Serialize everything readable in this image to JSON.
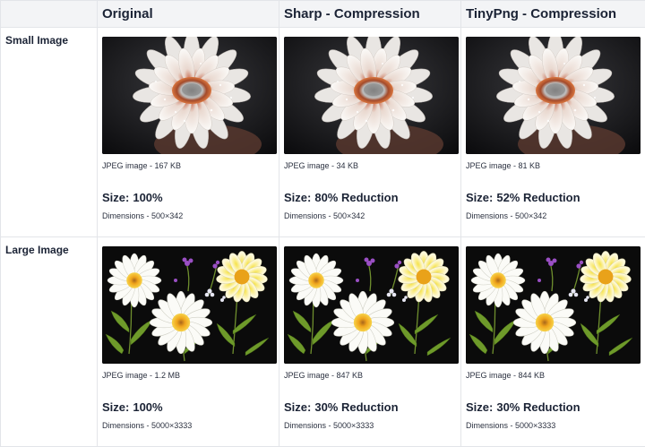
{
  "header": {
    "corner": "",
    "col_original": "Original",
    "col_sharp": "Sharp - Compression",
    "col_tinypng": "TinyPng - Compression"
  },
  "rows": [
    {
      "label": "Small Image",
      "image_subject": "white gerbera daisy with water droplets",
      "cells": [
        {
          "meta": "JPEG image - 167 KB",
          "size_label": "Size:",
          "size_value": "100%",
          "dims": "Dimensions - 500×342"
        },
        {
          "meta": "JPEG image - 34 KB",
          "size_label": "Size:",
          "size_value": "80% Reduction",
          "dims": "Dimensions - 500×342"
        },
        {
          "meta": "JPEG image - 81 KB",
          "size_label": "Size:",
          "size_value": "52% Reduction",
          "dims": "Dimensions - 500×342"
        }
      ]
    },
    {
      "label": "Large Image",
      "image_subject": "bouquet of white daisies and small purple flowers on black",
      "cells": [
        {
          "meta": "JPEG image - 1.2 MB",
          "size_label": "Size:",
          "size_value": "100%",
          "dims": "Dimensions - 5000×3333"
        },
        {
          "meta": "JPEG image - 847 KB",
          "size_label": "Size:",
          "size_value": "30% Reduction",
          "dims": "Dimensions - 5000×3333"
        },
        {
          "meta": "JPEG image - 844 KB",
          "size_label": "Size:",
          "size_value": "30% Reduction",
          "dims": "Dimensions - 5000×3333"
        }
      ]
    }
  ]
}
